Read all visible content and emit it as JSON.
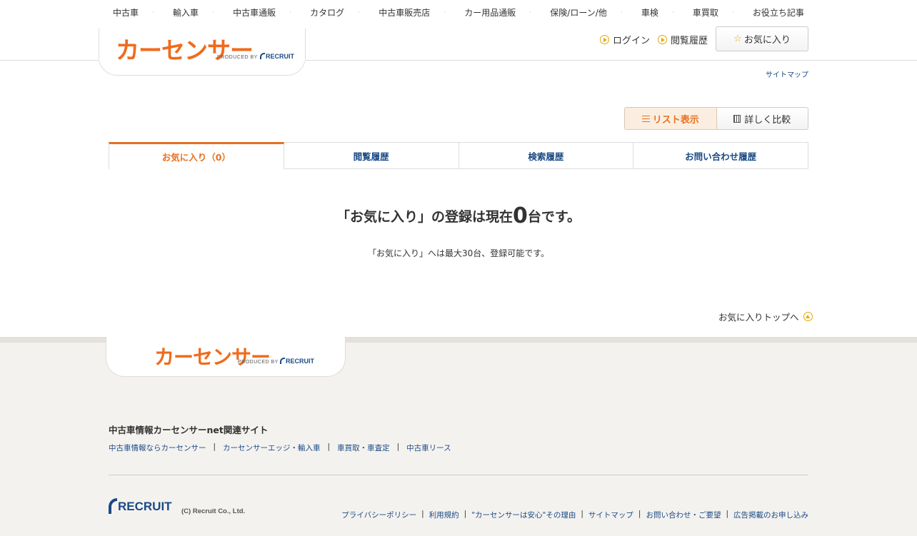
{
  "topnav": [
    "中古車",
    "輸入車",
    "中古車通販",
    "カタログ",
    "中古車販売店",
    "カー用品通販",
    "保険/ローン/他",
    "車検",
    "車買取",
    "お役立ち記事"
  ],
  "brand": {
    "logo": "カーセンサー",
    "produced_by": "PRODUCED BY",
    "recruit": "RECRUIT",
    "orange": "#f06b1c",
    "navy": "#1a4a85"
  },
  "header": {
    "login": "ログイン",
    "history": "閲覧履歴",
    "favorites": "お気に入り",
    "sitemap": "サイトマップ"
  },
  "view_toggle": {
    "list": "リスト表示",
    "compare": "詳しく比較",
    "selected": "list"
  },
  "tabs": [
    {
      "label": "お気に入り（0）",
      "active": true
    },
    {
      "label": "閲覧履歴",
      "active": false
    },
    {
      "label": "検索履歴",
      "active": false
    },
    {
      "label": "お問い合わせ履歴",
      "active": false
    }
  ],
  "message": {
    "prefix": "「お気に入り」の登録は現在",
    "count": "0",
    "suffix": "台です。",
    "sub": "「お気に入り」へは最大30台、登録可能です。"
  },
  "to_top": "お気に入りトップへ",
  "footer": {
    "related_title": "中古車情報カーセンサーnet関連サイト",
    "related_links": [
      "中古車情報ならカーセンサー",
      "カーセンサーエッジ・輸入車",
      "車買取・車査定",
      "中古車リース"
    ],
    "recruit": "RECRUIT",
    "copyright": "(C) Recruit Co., Ltd.",
    "legal_links": [
      "プライバシーポリシー",
      "利用規約",
      "\"カーセンサーは安心\"その理由",
      "サイトマップ",
      "お問い合わせ・ご要望",
      "広告掲載のお申し込み"
    ]
  }
}
